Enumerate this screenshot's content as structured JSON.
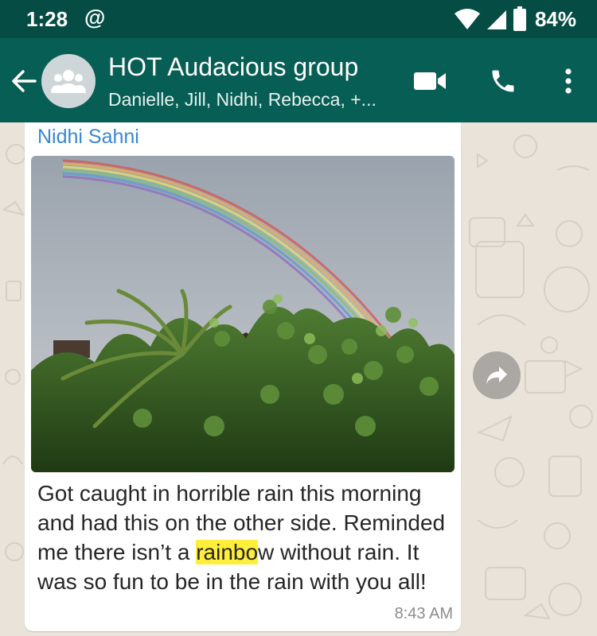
{
  "status_bar": {
    "time": "1:28",
    "at_symbol": "@",
    "battery_percent": "84%",
    "battery_level": 0.84,
    "icons": [
      "wifi-icon",
      "signal-icon",
      "battery-icon"
    ]
  },
  "header": {
    "title": "HOT Audacious group",
    "members": "Danielle, Jill, Nidhi, Rebecca, +...",
    "icons": [
      "back-arrow-icon",
      "group-avatar-icon",
      "video-call-icon",
      "phone-call-icon",
      "more-options-icon"
    ]
  },
  "message": {
    "sender": "Nidhi Sahni",
    "caption_before": "Got caught in horrible rain this morning and had this on the other side. Reminded me there isn’t a ",
    "caption_highlight": "rainbo",
    "caption_after": "w without rain. It was so fun to be in the rain with you all!",
    "time": "8:43 AM",
    "image_subject": "rainbow over tropical foliage"
  },
  "colors": {
    "header": "#075e54",
    "status_bar": "#054d44",
    "sender_name": "#3a86d4",
    "highlight": "#ffef3b",
    "chat_background": "#e9e3da"
  }
}
